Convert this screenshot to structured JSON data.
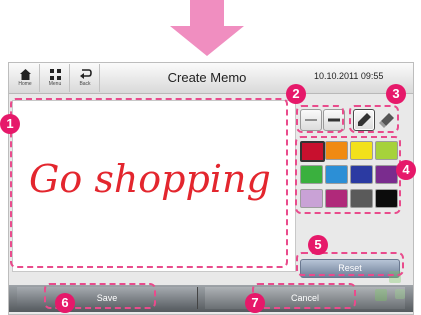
{
  "colors": {
    "accent": "#e6196a",
    "arrow": "#f08ec0",
    "palette": [
      "#c8102e",
      "#f08a12",
      "#f2e11b",
      "#a6d23b",
      "#3ab03e",
      "#2c8fd6",
      "#2b3aa2",
      "#7a2c8e",
      "#c9a2d6",
      "#b0297a",
      "#5a5a5a",
      "#0c0c0c"
    ]
  },
  "header": {
    "buttons": [
      {
        "icon": "home-icon",
        "label": "Home"
      },
      {
        "icon": "menu-icon",
        "label": "Menu"
      },
      {
        "icon": "back-icon",
        "label": "Back"
      }
    ],
    "title": "Create Memo",
    "datetime": "10.10.2011 09:55"
  },
  "canvas": {
    "handwriting": "Go shopping"
  },
  "tools": {
    "line_thin": "thin-line-icon",
    "line_thick": "thick-line-icon",
    "pen": "pen-icon",
    "eraser": "eraser-icon"
  },
  "reset_label": "Reset",
  "bottom": {
    "save_label": "Save",
    "cancel_label": "Cancel"
  },
  "callouts": [
    "1",
    "2",
    "3",
    "4",
    "5",
    "6",
    "7"
  ]
}
